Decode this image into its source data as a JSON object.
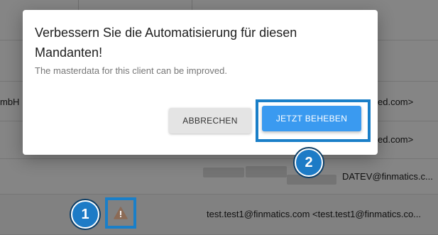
{
  "modal": {
    "title": "Verbessern Sie die Automatisierung für diesen Mandanten!",
    "subtitle": "The masterdata for this client can be improved.",
    "cancel_label": "ABBRECHEN",
    "fix_label": "JETZT BEHEBEN"
  },
  "table": {
    "row2_company_fragment": "mbH",
    "row2_email_fragment": "ed.com>",
    "row3_email_fragment": "ed.com>",
    "row4_email": "DATEV@finmatics.c...",
    "row5_email": "test.test1@finmatics.com <test.test1@finmatics.co...",
    "warning_icon": "warning-triangle-icon"
  },
  "markers": {
    "step1": "1",
    "step2": "2"
  },
  "colors": {
    "primary_button": "#3a9af0",
    "highlight_outline": "#1a7fc8",
    "marker_fill": "#1d7bc6",
    "warning": "#c0643a"
  }
}
